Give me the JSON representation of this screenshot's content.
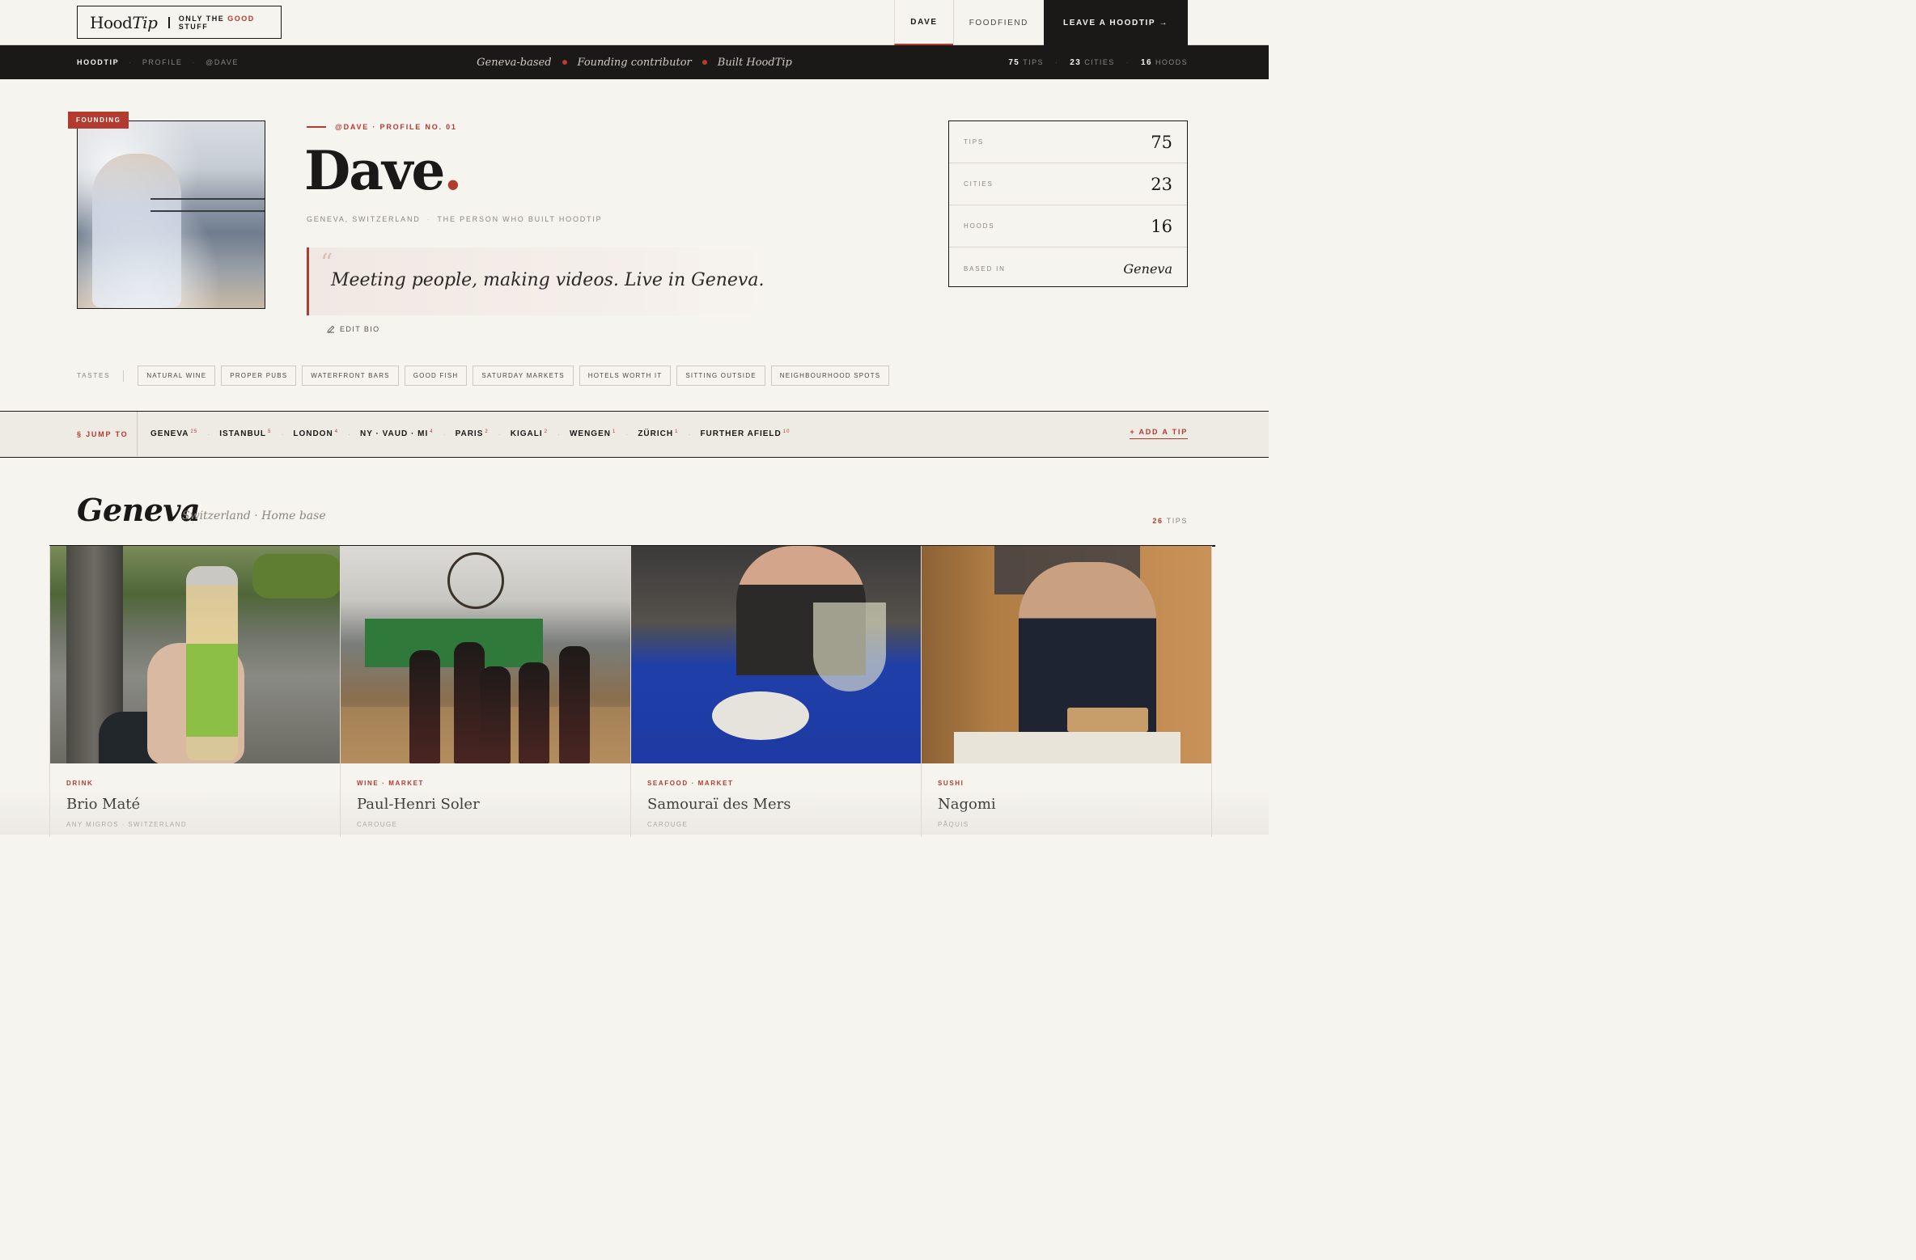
{
  "topbar": {
    "logo_main": "Hood",
    "logo_italic": "Tip",
    "logo_tag_pre": "ONLY THE ",
    "logo_tag_good": "GOOD",
    "logo_tag_post": " STUFF",
    "nav": [
      {
        "label": "DAVE",
        "active": true
      },
      {
        "label": "FOODFIEND",
        "active": false
      }
    ],
    "cta": "LEAVE A HOODTIP →"
  },
  "strip": {
    "crumbs": [
      "HOODTIP",
      "PROFILE",
      "@DAVE"
    ],
    "tagline": [
      "Geneva-based",
      "Founding contributor",
      "Built HoodTip"
    ],
    "stats": [
      {
        "num": "75",
        "label": "TIPS"
      },
      {
        "num": "23",
        "label": "CITIES"
      },
      {
        "num": "16",
        "label": "HOODS"
      }
    ]
  },
  "profile": {
    "badge": "FOUNDING",
    "eyebrow": "@DAVE · PROFILE NO. 01",
    "name": "Dave",
    "name_period": ".",
    "location": "GENEVA, SWITZERLAND",
    "role": "THE PERSON WHO BUILT HOODTIP",
    "quote_mark": "“",
    "quote": "Meeting people, making videos. Live in Geneva.",
    "edit_bio": "EDIT BIO"
  },
  "stats_card": [
    {
      "label": "TIPS",
      "value": "75"
    },
    {
      "label": "CITIES",
      "value": "23"
    },
    {
      "label": "HOODS",
      "value": "16"
    },
    {
      "label": "BASED IN",
      "value": "Geneva"
    }
  ],
  "tastes": {
    "label": "TASTES",
    "chips": [
      "NATURAL WINE",
      "PROPER PUBS",
      "WATERFRONT BARS",
      "GOOD FISH",
      "SATURDAY MARKETS",
      "HOTELS WORTH IT",
      "SITTING OUTSIDE",
      "NEIGHBOURHOOD SPOTS"
    ]
  },
  "jump": {
    "label": "§ JUMP TO",
    "items": [
      {
        "name": "GENEVA",
        "count": "25"
      },
      {
        "name": "ISTANBUL",
        "count": "5"
      },
      {
        "name": "LONDON",
        "count": "4"
      },
      {
        "name": "NY · VAUD · MI",
        "count": "4"
      },
      {
        "name": "PARIS",
        "count": "2"
      },
      {
        "name": "KIGALI",
        "count": "2"
      },
      {
        "name": "WENGEN",
        "count": "1"
      },
      {
        "name": "ZÜRICH",
        "count": "1"
      },
      {
        "name": "FURTHER AFIELD",
        "count": "10"
      }
    ],
    "add_tip": "+ ADD A TIP"
  },
  "section": {
    "title": "Geneva",
    "subtitle": "Switzerland · Home base",
    "count_num": "26",
    "count_label": "TIPS"
  },
  "cards": [
    {
      "category": "DRINK",
      "title": "Brio Maté",
      "location": "ANY MIGROS · SWITZERLAND"
    },
    {
      "category": "WINE · MARKET",
      "title": "Paul-Henri Soler",
      "location": "CAROUGE"
    },
    {
      "category": "SEAFOOD · MARKET",
      "title": "Samouraï des Mers",
      "location": "CAROUGE"
    },
    {
      "category": "SUSHI",
      "title": "Nagomi",
      "location": "PÂQUIS"
    }
  ],
  "colors": {
    "accent": "#b33a2e",
    "ink": "#1a1918",
    "paper": "#f6f4ef"
  }
}
